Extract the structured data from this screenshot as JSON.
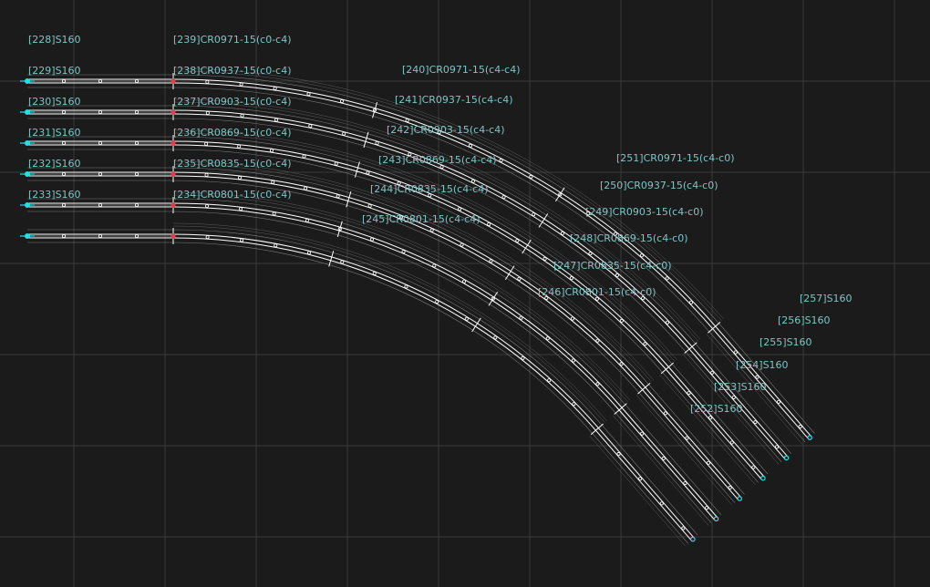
{
  "colors": {
    "background": "#1b1b1b",
    "grid": "#3a3a3a",
    "label": "#7fc4c4",
    "rail": "#ffffff",
    "endpoint_cyan": "#22e0e8",
    "joint_red": "#e83a4a"
  },
  "labels": [
    "[228]S160",
    "[229]S160",
    "[230]S160",
    "[231]S160",
    "[232]S160",
    "[233]S160",
    "[239]CR0971-15(c0-c4)",
    "[238]CR0937-15(c0-c4)",
    "[237]CR0903-15(c0-c4)",
    "[236]CR0869-15(c0-c4)",
    "[235]CR0835-15(c0-c4)",
    "[234]CR0801-15(c0-c4)",
    "[240]CR0971-15(c4-c4)",
    "[241]CR0937-15(c4-c4)",
    "[242]CR0903-15(c4-c4)",
    "[243]CR0869-15(c4-c4)",
    "[244]CR0835-15(c4-c4)",
    "[245]CR0801-15(c4-c4)",
    "[251]CR0971-15(c4-c0)",
    "[250]CR0937-15(c4-c0)",
    "[249]CR0903-15(c4-c0)",
    "[248]CR0869-15(c4-c0)",
    "[247]CR0835-15(c4-c0)",
    "[246]CR0801-15(c4-c0)",
    "[257]S160",
    "[256]S160",
    "[255]S160",
    "[254]S160",
    "[253]S160",
    "[252]S160"
  ]
}
